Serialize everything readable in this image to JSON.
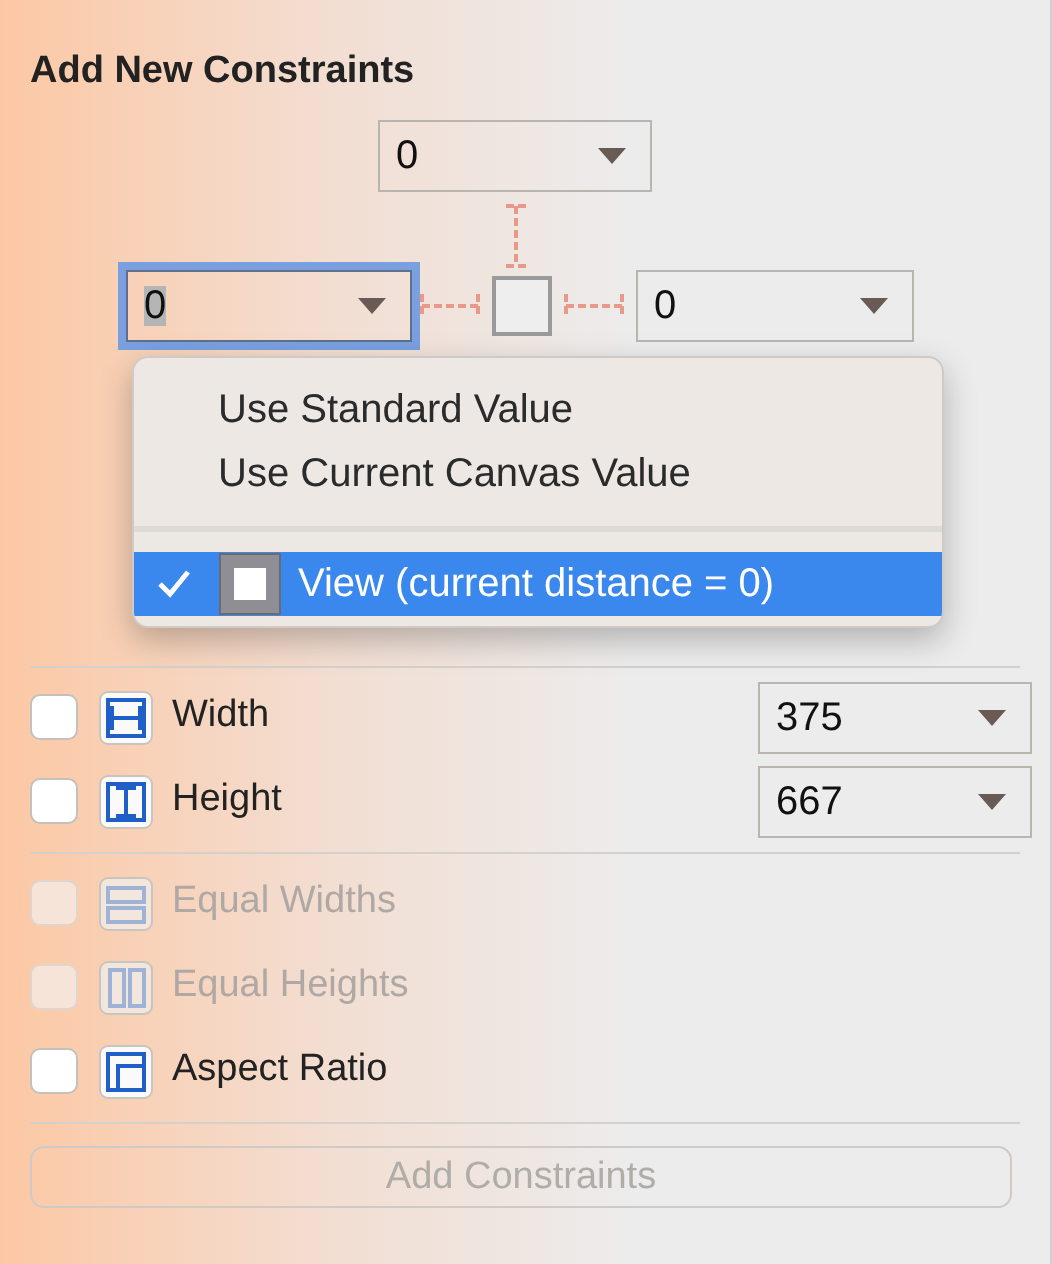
{
  "title": "Add New Constraints",
  "spacing": [
    {
      "value": "0",
      "focused": false
    },
    {
      "value": "0",
      "focused": true
    },
    {
      "value": "0",
      "focused": false
    }
  ],
  "menu": {
    "items": [
      {
        "kind": "option",
        "label": "Use Standard Value",
        "checked": false,
        "selected": false
      },
      {
        "kind": "option",
        "label": "Use Current Canvas Value",
        "checked": false,
        "selected": false
      },
      {
        "kind": "separator"
      },
      {
        "kind": "view",
        "label": "View (current distance = 0)",
        "checked": true,
        "selected": true
      }
    ]
  },
  "groups": [
    [
      {
        "kind": "width",
        "label": "Width",
        "checked": false,
        "disabled": false,
        "value": "375"
      },
      {
        "kind": "height",
        "label": "Height",
        "checked": false,
        "disabled": false,
        "value": "667"
      }
    ],
    [
      {
        "kind": "equal-widths",
        "label": "Equal Widths",
        "checked": false,
        "disabled": true
      },
      {
        "kind": "equal-heights",
        "label": "Equal Heights",
        "checked": false,
        "disabled": true
      },
      {
        "kind": "aspect",
        "label": "Aspect Ratio",
        "checked": false,
        "disabled": false
      }
    ]
  ],
  "button": {
    "label": "Add Constraints",
    "disabled": true
  }
}
